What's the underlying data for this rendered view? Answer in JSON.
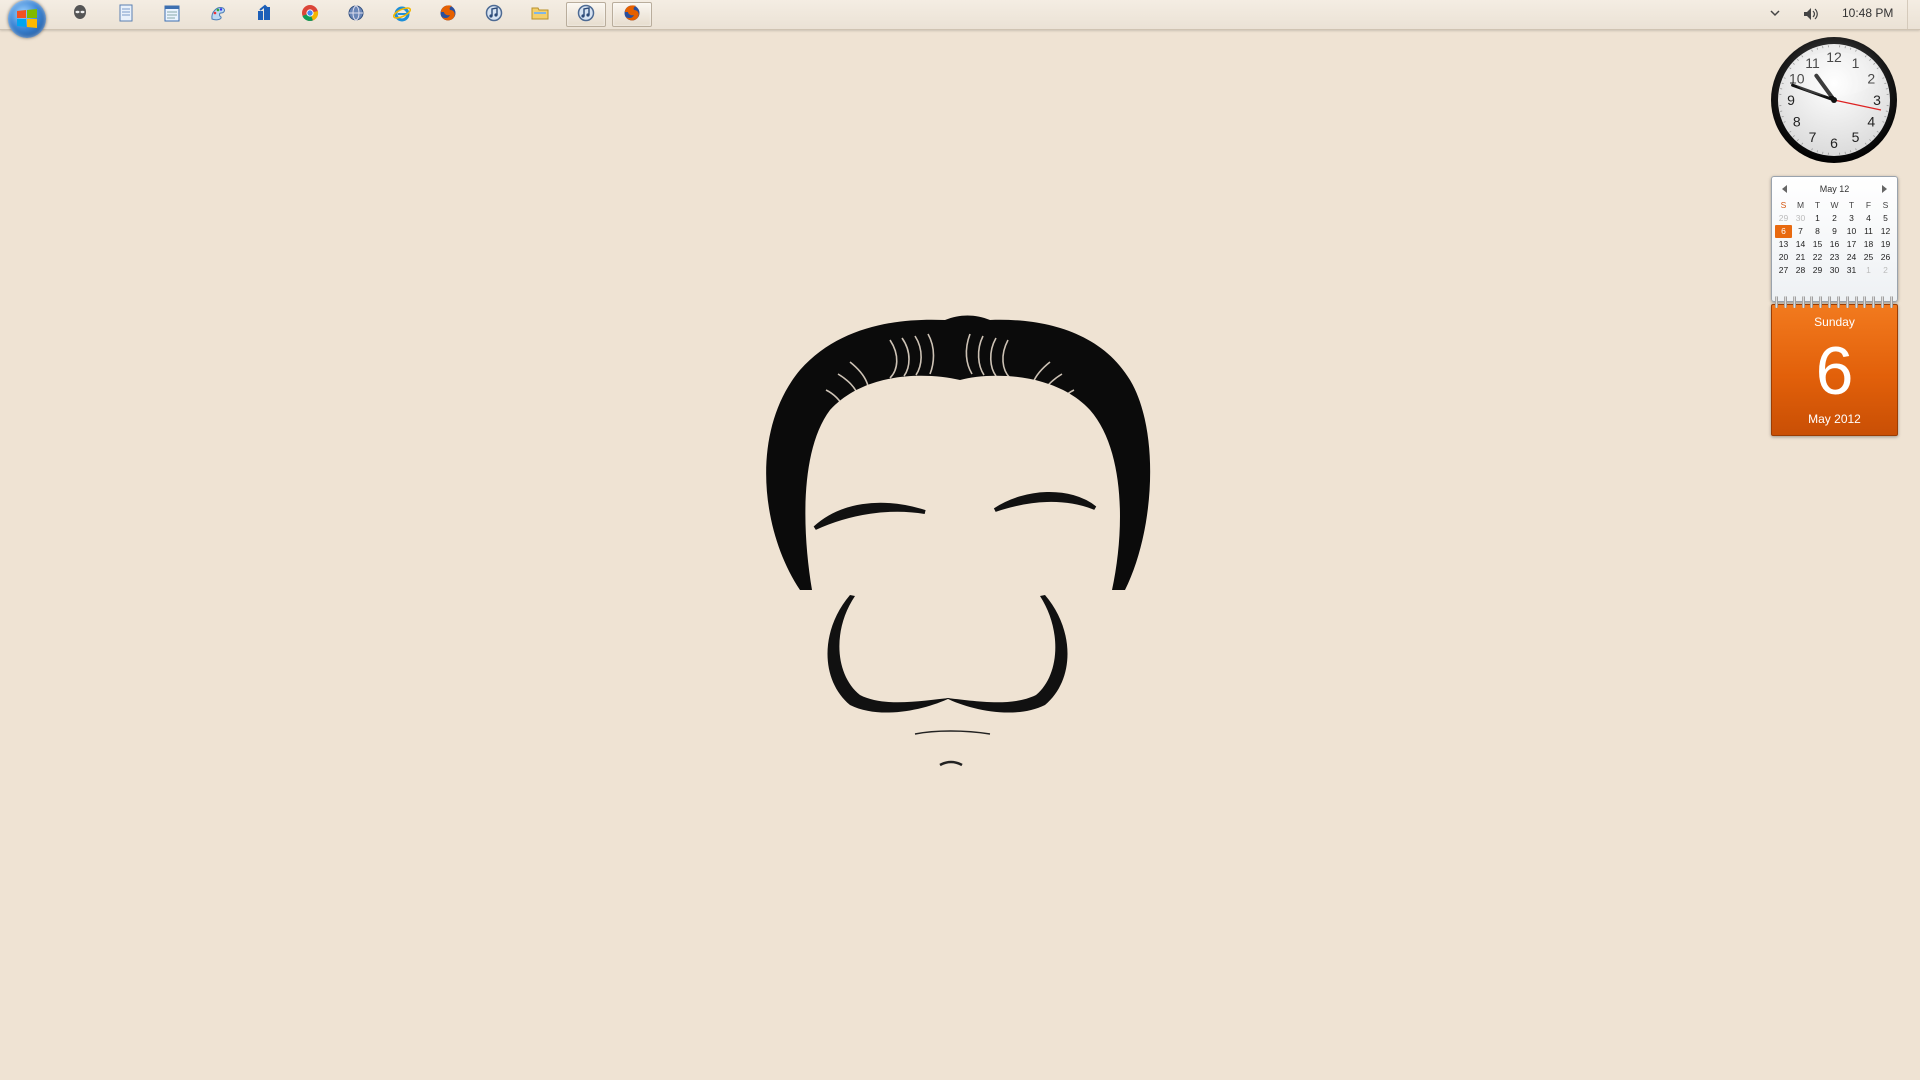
{
  "taskbar": {
    "pinned": [
      {
        "name": "alien-icon",
        "active": false
      },
      {
        "name": "document-icon",
        "active": false
      },
      {
        "name": "notepad-icon",
        "active": false
      },
      {
        "name": "paint-icon",
        "active": false
      },
      {
        "name": "blue-app-icon",
        "active": false
      },
      {
        "name": "chrome-icon",
        "active": false
      },
      {
        "name": "globe-icon",
        "active": false
      },
      {
        "name": "internet-explorer-icon",
        "active": false
      },
      {
        "name": "firefox-icon",
        "active": false
      },
      {
        "name": "itunes-icon",
        "active": false
      },
      {
        "name": "folder-icon",
        "active": false
      },
      {
        "name": "itunes-icon",
        "active": true
      },
      {
        "name": "firefox-icon",
        "active": true
      }
    ],
    "tray": {
      "time": "10:48 PM"
    }
  },
  "clock": {
    "numbers": [
      "12",
      "1",
      "2",
      "3",
      "4",
      "5",
      "6",
      "7",
      "8",
      "9",
      "10",
      "11"
    ],
    "hour": 22,
    "minute": 48,
    "second": 17
  },
  "calendar": {
    "header": "May 12",
    "weekdays": [
      "S",
      "M",
      "T",
      "W",
      "T",
      "F",
      "S"
    ],
    "weeks": [
      [
        {
          "d": "29",
          "muted": true
        },
        {
          "d": "30",
          "muted": true
        },
        {
          "d": "1"
        },
        {
          "d": "2"
        },
        {
          "d": "3"
        },
        {
          "d": "4"
        },
        {
          "d": "5"
        }
      ],
      [
        {
          "d": "6",
          "today": true
        },
        {
          "d": "7"
        },
        {
          "d": "8"
        },
        {
          "d": "9"
        },
        {
          "d": "10"
        },
        {
          "d": "11"
        },
        {
          "d": "12"
        }
      ],
      [
        {
          "d": "13"
        },
        {
          "d": "14"
        },
        {
          "d": "15"
        },
        {
          "d": "16"
        },
        {
          "d": "17"
        },
        {
          "d": "18"
        },
        {
          "d": "19"
        }
      ],
      [
        {
          "d": "20"
        },
        {
          "d": "21"
        },
        {
          "d": "22"
        },
        {
          "d": "23"
        },
        {
          "d": "24"
        },
        {
          "d": "25"
        },
        {
          "d": "26"
        }
      ],
      [
        {
          "d": "27"
        },
        {
          "d": "28"
        },
        {
          "d": "29"
        },
        {
          "d": "30"
        },
        {
          "d": "31"
        },
        {
          "d": "1",
          "muted": true
        },
        {
          "d": "2",
          "muted": true
        }
      ]
    ],
    "day_name": "Sunday",
    "day_number": "6",
    "month_year": "May 2012"
  },
  "colors": {
    "wallpaper": "#efe3d3",
    "calendar_accent": "#e8690f"
  }
}
